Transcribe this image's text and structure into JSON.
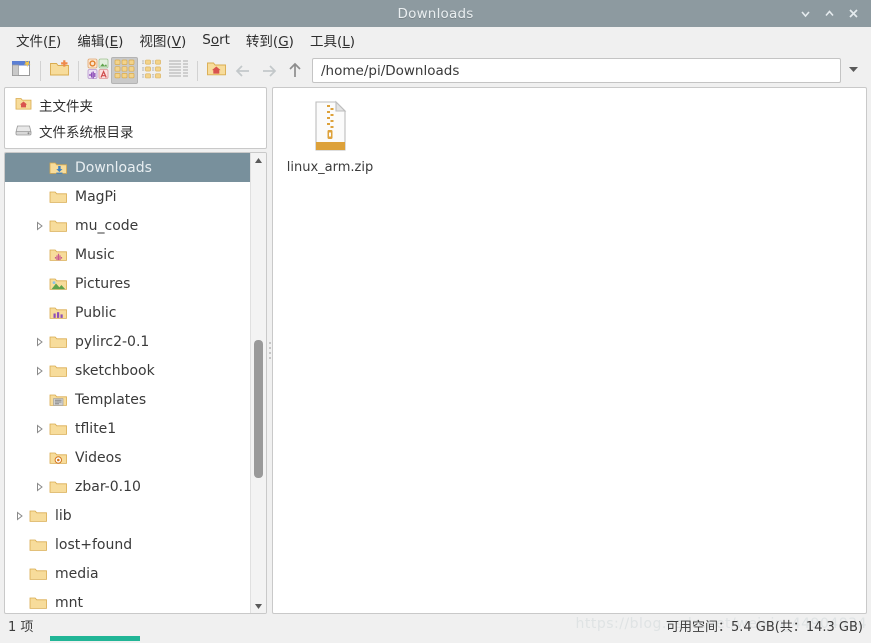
{
  "window": {
    "title": "Downloads",
    "controls": [
      {
        "name": "minimize-button",
        "glyph": "minimize"
      },
      {
        "name": "maximize-button",
        "glyph": "maximize"
      },
      {
        "name": "close-button",
        "glyph": "close"
      }
    ]
  },
  "menubar": {
    "items": [
      {
        "text": "文件",
        "mnemonic": "F"
      },
      {
        "text": "编辑",
        "mnemonic": "E"
      },
      {
        "text": "视图",
        "mnemonic": "V"
      },
      {
        "text": "S",
        "mnemonic": "o",
        "tail": "rt"
      },
      {
        "text": "转到",
        "mnemonic": "G"
      },
      {
        "text": "工具",
        "mnemonic": "L"
      }
    ]
  },
  "toolbar": {
    "buttons": [
      {
        "name": "new-tab-icon",
        "label": "新建标签页"
      },
      {
        "name": "new-folder-icon",
        "label": "新建文件夹"
      },
      {
        "name": "app-icons-view-icon",
        "label": "应用程序图标"
      },
      {
        "name": "icon-view-icon",
        "label": "图标视图",
        "active": true
      },
      {
        "name": "compact-view-icon",
        "label": "紧凑视图"
      },
      {
        "name": "detailed-list-view-icon",
        "label": "详细列表视图"
      },
      {
        "name": "home-icon",
        "label": "主文件夹"
      }
    ],
    "nav": [
      {
        "name": "back-icon",
        "label": "后退"
      },
      {
        "name": "forward-icon",
        "label": "前进"
      },
      {
        "name": "up-icon",
        "label": "上一级"
      }
    ],
    "path": {
      "value": "/home/pi/Downloads",
      "placeholder": "/home/pi/Downloads",
      "dropdown_icon": "chevron-down-icon"
    }
  },
  "sidebar": {
    "places": [
      {
        "label": "主文件夹",
        "icon": "home-folder-icon"
      },
      {
        "label": "文件系统根目录",
        "icon": "drive-icon"
      }
    ],
    "tree": [
      {
        "label": "Downloads",
        "icon": "downloads-folder-icon",
        "indent": 1,
        "expandable": false,
        "selected": true
      },
      {
        "label": "MagPi",
        "icon": "folder-icon",
        "indent": 1,
        "expandable": false,
        "selected": false
      },
      {
        "label": "mu_code",
        "icon": "folder-icon",
        "indent": 1,
        "expandable": true,
        "selected": false
      },
      {
        "label": "Music",
        "icon": "music-folder-icon",
        "indent": 1,
        "expandable": false,
        "selected": false
      },
      {
        "label": "Pictures",
        "icon": "pictures-folder-icon",
        "indent": 1,
        "expandable": false,
        "selected": false
      },
      {
        "label": "Public",
        "icon": "public-folder-icon",
        "indent": 1,
        "expandable": false,
        "selected": false
      },
      {
        "label": "pylirc2-0.1",
        "icon": "folder-icon",
        "indent": 1,
        "expandable": true,
        "selected": false
      },
      {
        "label": "sketchbook",
        "icon": "folder-icon",
        "indent": 1,
        "expandable": true,
        "selected": false
      },
      {
        "label": "Templates",
        "icon": "templates-folder-icon",
        "indent": 1,
        "expandable": false,
        "selected": false
      },
      {
        "label": "tflite1",
        "icon": "folder-icon",
        "indent": 1,
        "expandable": true,
        "selected": false
      },
      {
        "label": "Videos",
        "icon": "videos-folder-icon",
        "indent": 1,
        "expandable": false,
        "selected": false
      },
      {
        "label": "zbar-0.10",
        "icon": "folder-icon",
        "indent": 1,
        "expandable": true,
        "selected": false
      },
      {
        "label": "lib",
        "icon": "folder-icon",
        "indent": 0,
        "expandable": true,
        "selected": false
      },
      {
        "label": "lost+found",
        "icon": "folder-icon",
        "indent": 0,
        "expandable": false,
        "selected": false
      },
      {
        "label": "media",
        "icon": "folder-icon",
        "indent": 0,
        "expandable": false,
        "selected": false
      },
      {
        "label": "mnt",
        "icon": "folder-icon",
        "indent": 0,
        "expandable": false,
        "selected": false
      }
    ]
  },
  "files": [
    {
      "name": "linux_arm.zip",
      "icon": "zip-archive-icon"
    }
  ],
  "statusbar": {
    "left": "1 项",
    "right": "可用空间：5.4 GB(共：14.3 GB)",
    "watermark": "https://blog.csdn.net/weixin_44904834"
  },
  "colors": {
    "titlebar": "#8d9aa0",
    "selection": "#78909c",
    "folder": "#f3d38a",
    "accent_bar": "#21b596"
  }
}
